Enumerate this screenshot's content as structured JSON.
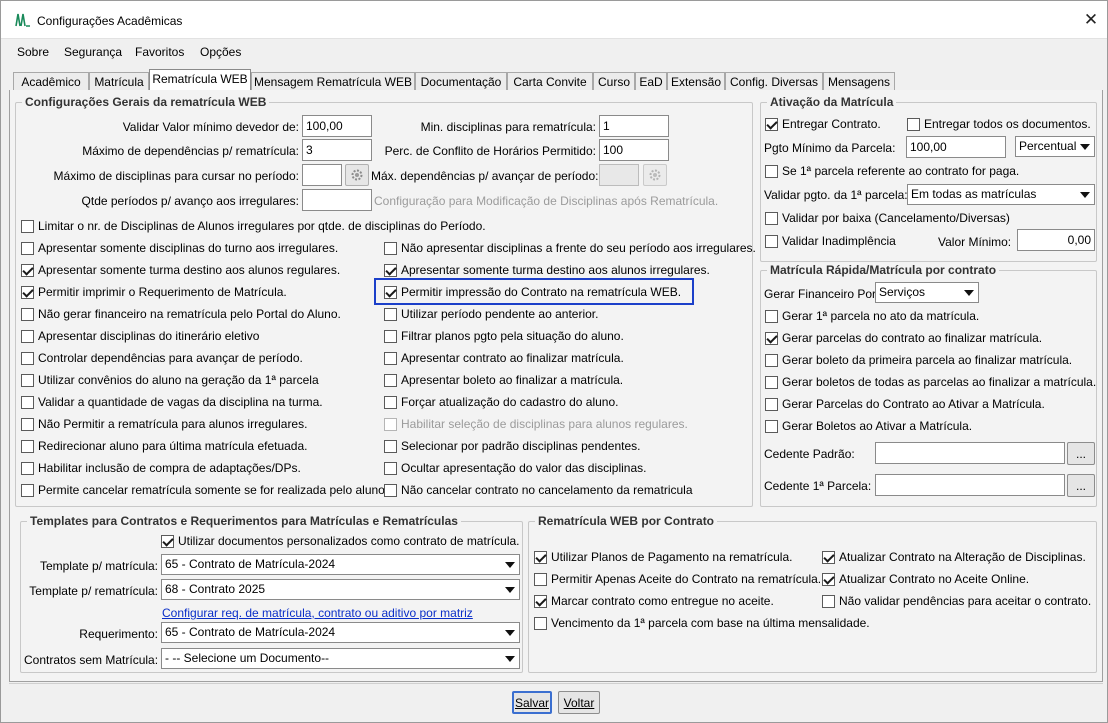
{
  "window": {
    "title": "Configurações Acadêmicas",
    "close": "✕"
  },
  "menu": {
    "sobre": "Sobre",
    "seguranca": "Segurança",
    "favoritos": "Favoritos",
    "opcoes": "Opções"
  },
  "tabs": {
    "academico": "Acadêmico",
    "matricula": "Matrícula",
    "rematricula_web": "Rematrícula WEB",
    "mensagem": "Mensagem Rematrícula WEB",
    "documentacao": "Documentação",
    "carta_convite": "Carta Convite",
    "curso": "Curso",
    "ead": "EaD",
    "extensao": "Extensão",
    "config_diversas": "Config. Diversas",
    "mensagens": "Mensagens"
  },
  "geral": {
    "legend": "Configurações Gerais da rematrícula WEB",
    "validar_label": "Validar Valor mínimo devedor de:",
    "validar_value": "100,00",
    "max_dep_label": "Máximo de dependências p/ rematrícula:",
    "max_dep_value": "3",
    "max_disc_label": "Máximo de disciplinas para cursar no período:",
    "max_disc_value": "",
    "qtde_label": "Qtde períodos p/ avanço aos irregulares:",
    "qtde_value": "",
    "min_disc_label": "Min. disciplinas para rematrícula:",
    "min_disc_value": "1",
    "perc_label": "Perc. de Conflito de Horários Permitido:",
    "perc_value": "100",
    "max_dep_avanco_label": "Máx. dependências p/ avançar de período:",
    "config_mod_label": "Configuração para Modificação de Disciplinas após Rematrícula.",
    "limitar": "Limitar o nr. de Disciplinas de Alunos irregulares por qtde. de disciplinas do Período.",
    "left": [
      {
        "label": "Apresentar somente disciplinas do turno aos irregulares.",
        "checked": false
      },
      {
        "label": "Apresentar somente turma destino aos alunos regulares.",
        "checked": true
      },
      {
        "label": "Permitir imprimir o Requerimento de Matrícula.",
        "checked": true
      },
      {
        "label": "Não gerar financeiro na rematrícula pelo Portal do Aluno.",
        "checked": false
      },
      {
        "label": "Apresentar disciplinas do itinerário eletivo",
        "checked": false
      },
      {
        "label": "Controlar dependências para avançar de período.",
        "checked": false
      },
      {
        "label": "Utilizar convênios do aluno na geração da 1ª parcela",
        "checked": false
      },
      {
        "label": "Validar a quantidade de vagas da disciplina na turma.",
        "checked": false
      },
      {
        "label": "Não Permitir a rematrícula para alunos irregulares.",
        "checked": false
      },
      {
        "label": "Redirecionar aluno para última matrícula efetuada.",
        "checked": false
      },
      {
        "label": "Habilitar inclusão de compra de adaptações/DPs.",
        "checked": false
      },
      {
        "label": "Permite cancelar rematrícula somente se for realizada pelo aluno.",
        "checked": false
      }
    ],
    "right": [
      {
        "label": "Não apresentar disciplinas a frente do seu período aos irregulares.",
        "checked": false
      },
      {
        "label": "Apresentar somente turma destino aos alunos irregulares.",
        "checked": true
      },
      {
        "label": "Permitir impressão do Contrato na rematrícula WEB.",
        "checked": true
      },
      {
        "label": "Utilizar período pendente ao anterior.",
        "checked": false
      },
      {
        "label": "Filtrar planos pgto pela situação do aluno.",
        "checked": false
      },
      {
        "label": "Apresentar contrato ao finalizar matrícula.",
        "checked": false
      },
      {
        "label": "Apresentar boleto ao finalizar a matrícula.",
        "checked": false
      },
      {
        "label": "Forçar atualização do cadastro do aluno.",
        "checked": false
      },
      {
        "label": "Habilitar seleção de disciplinas para alunos regulares.",
        "checked": false
      },
      {
        "label": "Selecionar por padrão disciplinas pendentes.",
        "checked": false
      },
      {
        "label": "Ocultar apresentação do valor das disciplinas.",
        "checked": false
      },
      {
        "label": "Não cancelar contrato no cancelamento da rematricula",
        "checked": false
      }
    ]
  },
  "ativacao": {
    "legend": "Ativação da Matrícula",
    "entregar_contrato": "Entregar Contrato.",
    "entregar_docs": "Entregar todos os documentos.",
    "pgto_label": "Pgto Mínimo da Parcela:",
    "pgto_value": "100,00",
    "pgto_tipo": "Percentual",
    "primeira_parcela": "Se 1ª parcela referente ao contrato for paga.",
    "validar_pgto_label": "Validar pgto. da 1ª parcela:",
    "validar_pgto_value": "Em todas as matrículas",
    "validar_baixa": "Validar por baixa (Cancelamento/Diversas)",
    "validar_inad": "Validar Inadimplência",
    "valor_min_label": "Valor Mínimo:",
    "valor_min_value": "0,00"
  },
  "rapida": {
    "legend": "Matrícula Rápida/Matrícula por contrato",
    "gerar_fin_label": "Gerar Financeiro Por:",
    "gerar_fin_value": "Serviços",
    "items": [
      {
        "label": "Gerar 1ª parcela no ato da matrícula.",
        "checked": false
      },
      {
        "label": "Gerar parcelas do contrato ao finalizar matrícula.",
        "checked": true
      },
      {
        "label": "Gerar boleto da primeira parcela ao finalizar matrícula.",
        "checked": false
      },
      {
        "label": "Gerar boletos de todas as parcelas ao finalizar a matrícula.",
        "checked": false
      },
      {
        "label": "Gerar Parcelas do Contrato ao Ativar a Matrícula.",
        "checked": false
      },
      {
        "label": "Gerar Boletos ao Ativar a Matrícula.",
        "checked": false
      }
    ],
    "cedente_label": "Cedente Padrão:",
    "cedente1_label": "Cedente 1ª Parcela:",
    "dots": "..."
  },
  "templates": {
    "legend": "Templates para Contratos e Requerimentos para Matrículas e Rematrículas",
    "utilizar": "Utilizar documentos personalizados como contrato de matrícula.",
    "tm_label": "Template p/ matrícula:",
    "tm_value": "65 - Contrato de Matrícula-2024",
    "tr_label": "Template p/ rematrícula:",
    "tr_value": "68 - Contrato 2025",
    "link": "Configurar req. de matrícula, contrato ou aditivo por matriz",
    "req_label": "Requerimento:",
    "req_value": "65 - Contrato de Matrícula-2024",
    "csm_label": "Contratos sem Matrícula:",
    "csm_value": "- -- Selecione um Documento--"
  },
  "contrato": {
    "legend": "Rematrícula WEB por Contrato",
    "left": [
      {
        "label": "Utilizar Planos de Pagamento na rematrícula.",
        "checked": true
      },
      {
        "label": "Permitir Apenas Aceite do Contrato na rematrícula.",
        "checked": false
      },
      {
        "label": "Marcar contrato como entregue no aceite.",
        "checked": true
      },
      {
        "label": "Vencimento da 1ª parcela com base na última mensalidade.",
        "checked": false
      }
    ],
    "right": [
      {
        "label": "Atualizar Contrato na Alteração de Disciplinas.",
        "checked": true
      },
      {
        "label": "Atualizar Contrato no Aceite Online.",
        "checked": true
      },
      {
        "label": "Não validar pendências para aceitar o contrato.",
        "checked": false
      }
    ]
  },
  "footer": {
    "salvar": "Salvar",
    "voltar": "Voltar"
  }
}
